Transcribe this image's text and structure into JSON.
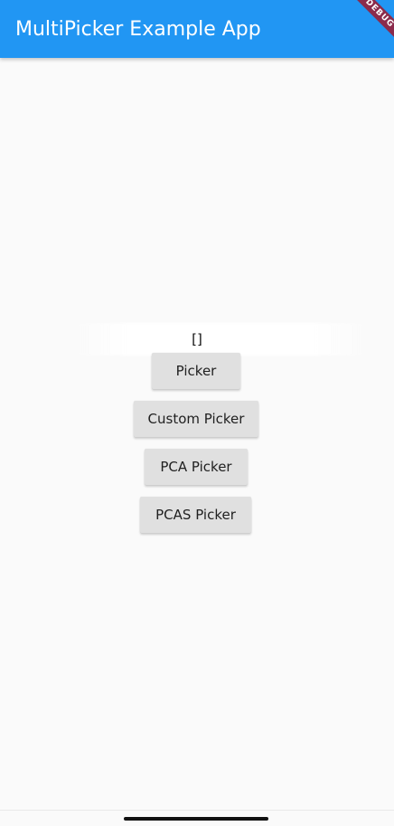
{
  "app_bar": {
    "title": "MultiPicker Example App",
    "background_color": "#2196f3",
    "text_color": "#ffffff"
  },
  "debug_banner": {
    "label": "DEBUG",
    "color": "#8b2b4c"
  },
  "main": {
    "result_text": "[]",
    "buttons": [
      {
        "label": "Picker"
      },
      {
        "label": "Custom Picker"
      },
      {
        "label": "PCA Picker"
      },
      {
        "label": "PCAS Picker"
      }
    ],
    "button_color": "#e0e0e0"
  },
  "system": {
    "home_indicator": "home-indicator"
  }
}
